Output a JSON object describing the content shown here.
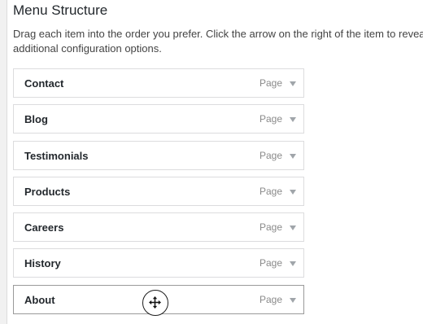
{
  "header": {
    "title": "Menu Structure",
    "instructions": "Drag each item into the order you prefer. Click the arrow on the right of the item to reveal additional configuration options."
  },
  "menu": {
    "items": [
      {
        "label": "Contact",
        "type": "Page"
      },
      {
        "label": "Blog",
        "type": "Page"
      },
      {
        "label": "Testimonials",
        "type": "Page"
      },
      {
        "label": "Products",
        "type": "Page"
      },
      {
        "label": "Careers",
        "type": "Page"
      },
      {
        "label": "History",
        "type": "Page"
      },
      {
        "label": "About",
        "type": "Page"
      }
    ]
  },
  "cursor": {
    "icon": "move-cursor-icon"
  }
}
